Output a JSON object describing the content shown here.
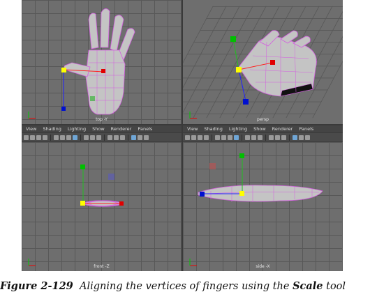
{
  "viewports": {
    "top": {
      "label": "top -Y"
    },
    "persp": {
      "label": "persp"
    },
    "front": {
      "label": "front -Z"
    },
    "side": {
      "label": "side -X"
    }
  },
  "panel_menu": {
    "items": [
      "View",
      "Shading",
      "Lighting",
      "Show",
      "Renderer",
      "Panels"
    ]
  },
  "caption": {
    "figure": "Figure 2-129",
    "text_before": "Aligning the vertices of fingers using the",
    "tool": "Scale",
    "text_after": "tool"
  },
  "colors": {
    "viewport_bg": "#6e6e6e",
    "mesh": "#c4c4c4",
    "wire": "#d45de0",
    "handle_x": "#e00000",
    "handle_y": "#00c000",
    "handle_z": "#0010d0",
    "handle_center": "#ffff00"
  }
}
